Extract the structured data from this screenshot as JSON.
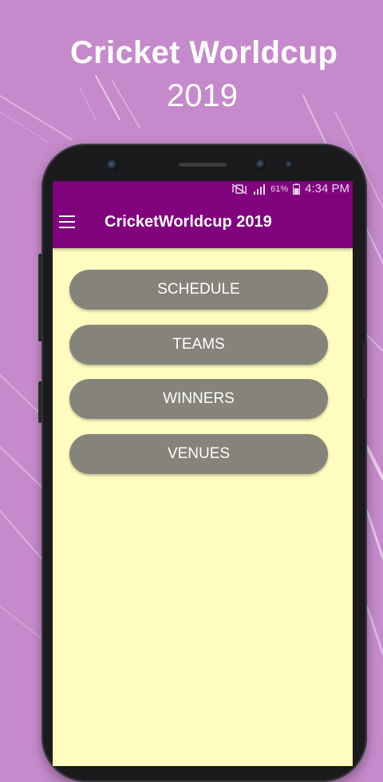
{
  "promo": {
    "title": "Cricket Worldcup",
    "year": "2019"
  },
  "statusbar": {
    "battery": "61%",
    "time": "4:34 PM"
  },
  "appbar": {
    "title": "CricketWorldcup 2019",
    "menu_icon": "hamburger-menu-icon"
  },
  "menu": {
    "items": [
      {
        "label": "SCHEDULE"
      },
      {
        "label": "TEAMS"
      },
      {
        "label": "WINNERS"
      },
      {
        "label": "VENUES"
      }
    ]
  },
  "colors": {
    "background": "#c58acb",
    "appbar": "#80027d",
    "screen": "#fefcbf",
    "button": "#85837a",
    "button_text": "#ffffff"
  }
}
